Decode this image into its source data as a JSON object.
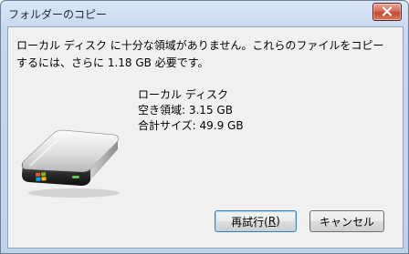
{
  "window": {
    "title": "フォルダーのコピー"
  },
  "message": {
    "line1": "ローカル ディスク に十分な領域がありません。これらのファイルをコピー",
    "line2": "するには、さらに 1.18 GB 必要です。"
  },
  "drive_info": {
    "name": "ローカル ディスク",
    "free_space": "空き領域: 3.15 GB",
    "total_size": "合計サイズ: 49.9 GB"
  },
  "buttons": {
    "retry_prefix": "再試行(",
    "retry_accesskey": "R",
    "retry_suffix": ")",
    "cancel": "キャンセル"
  },
  "colors": {
    "titlebar": "#c7d9ee",
    "client_background": "#f0f0f0",
    "close_button": "#c24a30",
    "default_button_border": "#3c7fb1"
  },
  "icons": {
    "close": "close-icon",
    "drive": "hard-drive-icon"
  }
}
